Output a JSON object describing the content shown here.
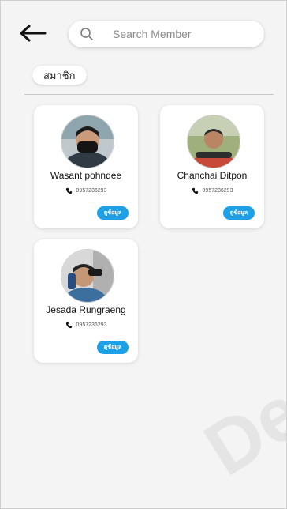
{
  "header": {
    "search_placeholder": "Search Member",
    "back_icon": "arrow-left-icon",
    "search_icon": "search-icon"
  },
  "section": {
    "chip_label": "สมาชิก"
  },
  "members": [
    {
      "name": "Wasant pohndee",
      "phone": "0957236293",
      "button_label": "ดูข้อมูล",
      "phone_icon": "phone-icon"
    },
    {
      "name": "Chanchai Ditpon",
      "phone": "0957236293",
      "button_label": "ดูข้อมูล",
      "phone_icon": "phone-icon"
    },
    {
      "name": "Jesada Rungraeng",
      "phone": "0957236293",
      "button_label": "ดูข้อมูล",
      "phone_icon": "phone-icon"
    }
  ],
  "watermark": {
    "text": "Dep"
  },
  "colors": {
    "accent": "#1ea0e6",
    "background": "#f4f4f4",
    "card": "#ffffff"
  }
}
